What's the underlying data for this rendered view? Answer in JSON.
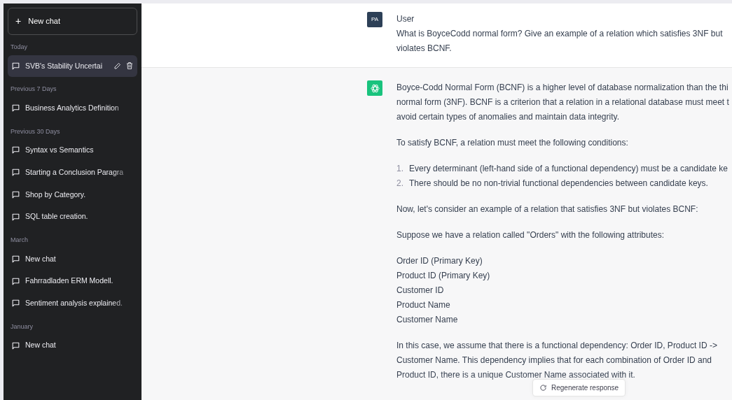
{
  "sidebar": {
    "new_chat": {
      "icon": "+",
      "label": "New chat"
    },
    "groups": [
      {
        "label": "Today",
        "items": [
          {
            "title": "SVB's Stability Uncertai",
            "selected": true
          }
        ]
      },
      {
        "label": "Previous 7 Days",
        "items": [
          {
            "title": "Business Analytics Definition",
            "selected": false
          }
        ]
      },
      {
        "label": "Previous 30 Days",
        "items": [
          {
            "title": "Syntax vs Semantics",
            "selected": false
          },
          {
            "title": "Starting a Conclusion Paragra",
            "selected": false
          },
          {
            "title": "Shop by Category.",
            "selected": false
          },
          {
            "title": "SQL table creation.",
            "selected": false
          }
        ]
      },
      {
        "label": "March",
        "items": [
          {
            "title": "New chat",
            "selected": false
          },
          {
            "title": "Fahrradladen ERM Modell.",
            "selected": false
          },
          {
            "title": "Sentiment analysis explained.",
            "selected": false
          }
        ]
      },
      {
        "label": "January",
        "items": [
          {
            "title": "New chat",
            "selected": false
          }
        ]
      }
    ]
  },
  "messages": [
    {
      "kind": "user",
      "avatar": "PA",
      "author": "User",
      "blocks": [
        {
          "kind": "lines",
          "lines": [
            "What is BoyceCodd normal form? Give an example of a relation which satisfies 3NF but",
            "violates BCNF."
          ]
        }
      ]
    },
    {
      "kind": "assistant",
      "blocks": [
        {
          "kind": "lines",
          "lines": [
            "Boyce-Codd Normal Form (BCNF) is a higher level of database normalization than the thi",
            "normal form (3NF). BCNF is a criterion that a relation in a relational database must meet t",
            "avoid certain types of anomalies and maintain data integrity."
          ]
        },
        {
          "kind": "lines",
          "lines": [
            "To satisfy BCNF, a relation must meet the following conditions:"
          ]
        },
        {
          "kind": "list",
          "items": [
            {
              "number": "1.",
              "text": "Every determinant (left-hand side of a functional dependency) must be a candidate ke"
            },
            {
              "number": "2.",
              "text": "There should be no non-trivial functional dependencies between candidate keys."
            }
          ]
        },
        {
          "kind": "lines",
          "lines": [
            "Now, let's consider an example of a relation that satisfies 3NF but violates BCNF:"
          ]
        },
        {
          "kind": "lines",
          "lines": [
            "Suppose we have a relation called \"Orders\" with the following attributes:"
          ]
        },
        {
          "kind": "lines",
          "lines": [
            "Order ID (Primary Key)",
            "Product ID (Primary Key)",
            "Customer ID",
            "Product Name",
            "Customer Name"
          ]
        },
        {
          "kind": "lines",
          "lines": [
            "In this case, we assume that there is a functional dependency: Order ID, Product ID ->",
            "Customer Name. This dependency implies that for each combination of Order ID and",
            "Product ID, there is a unique Customer Name associated with it."
          ]
        }
      ]
    }
  ],
  "regenerate_button": {
    "label": "Regenerate response"
  }
}
